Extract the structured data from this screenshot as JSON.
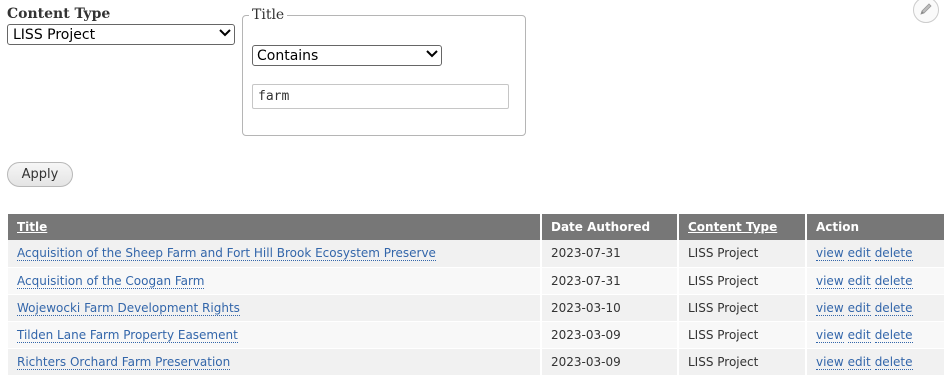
{
  "filters": {
    "content_type": {
      "label": "Content Type",
      "selected": "LISS Project"
    },
    "title": {
      "legend": "Title",
      "operator": "Contains",
      "value": "farm"
    },
    "apply_label": "Apply"
  },
  "table": {
    "columns": [
      "Title",
      "Date Authored",
      "Content Type",
      "Action"
    ],
    "rows": [
      {
        "title": "Acquisition of the Sheep Farm and Fort Hill Brook Ecosystem Preserve",
        "date": "2023-07-31",
        "type": "LISS Project"
      },
      {
        "title": "Acquisition of the Coogan Farm",
        "date": "2023-07-31",
        "type": "LISS Project"
      },
      {
        "title": "Wojewocki Farm Development Rights",
        "date": "2023-03-10",
        "type": "LISS Project"
      },
      {
        "title": "Tilden Lane Farm Property Easement",
        "date": "2023-03-09",
        "type": "LISS Project"
      },
      {
        "title": "Richters Orchard Farm Preservation",
        "date": "2023-03-09",
        "type": "LISS Project"
      }
    ],
    "actions": {
      "view": "view",
      "edit": "edit",
      "delete": "delete"
    }
  },
  "icons": {
    "edit_page": "pencil-icon",
    "select_arrow": "chevron-down-icon"
  },
  "colors": {
    "link": "#3366aa",
    "header_bg": "#777777",
    "row_bg": "#f1f1f1"
  }
}
